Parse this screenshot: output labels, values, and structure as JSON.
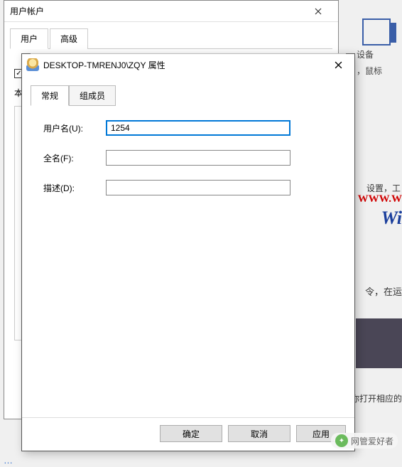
{
  "bg_dialog": {
    "title": "用户帐户",
    "tabs": {
      "users": "用户",
      "advanced": "高级"
    },
    "checkbox_checked": "✓",
    "text_row_prefix": "本"
  },
  "properties_dialog": {
    "title": "DESKTOP-TMRENJ0\\ZQY 属性",
    "tabs": {
      "general": "常规",
      "members": "组成员"
    },
    "form": {
      "username_label": "用户名(U):",
      "username_value": "1254",
      "fullname_label": "全名(F):",
      "fullname_value": "",
      "description_label": "描述(D):",
      "description_value": ""
    },
    "buttons": {
      "ok": "确定",
      "cancel": "取消",
      "apply": "应用"
    }
  },
  "bg_right": {
    "devices_label": "设备",
    "mouse_fragment": "，鼠标",
    "settings_fragment": "设置，工",
    "www_fragment": "WWW.W",
    "wi_fragment": "Wi",
    "run_fragment": "令，在运",
    "open_fragment": "你打开相应的"
  },
  "watermark": {
    "label": "网管爱好者"
  },
  "bottom_link": "…"
}
